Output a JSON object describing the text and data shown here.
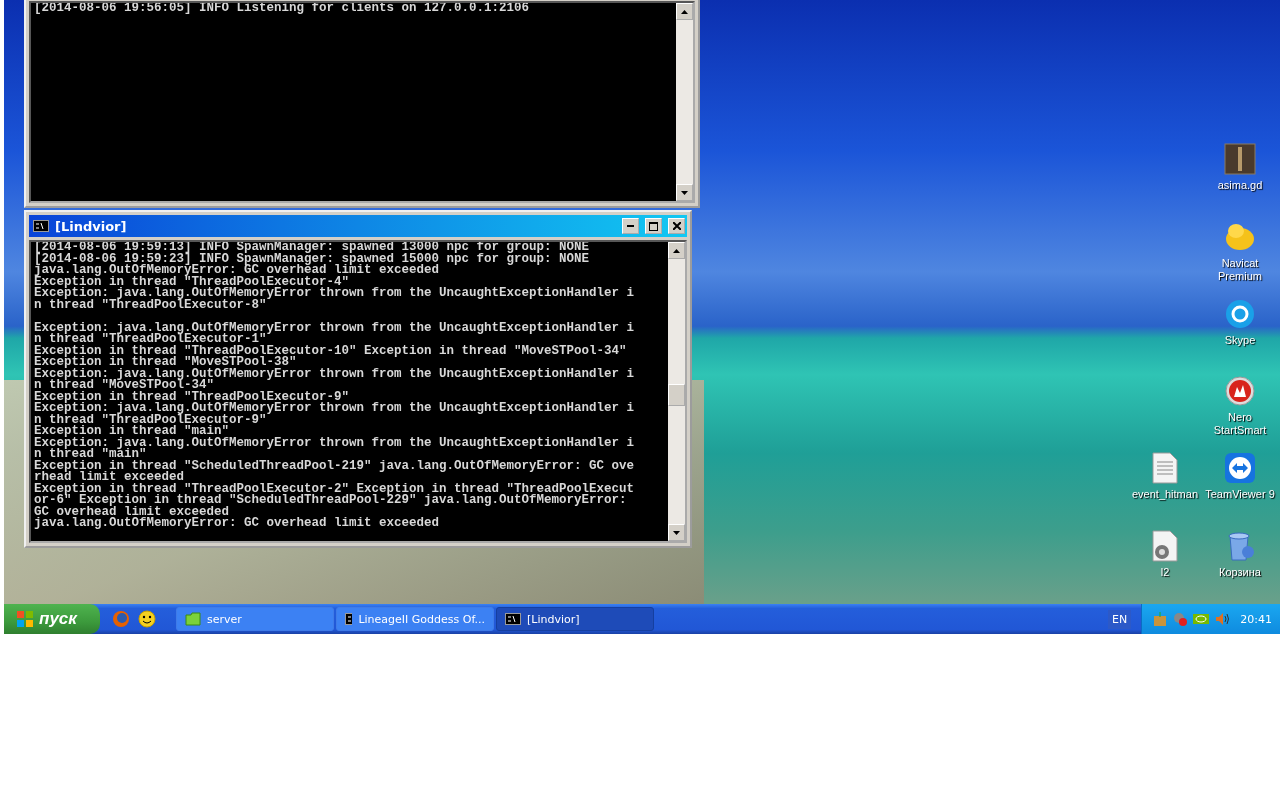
{
  "desktop": {
    "icons": [
      {
        "label": "asima.gd",
        "kind": "game"
      },
      {
        "label": "Navicat Premium",
        "kind": "navicat"
      },
      {
        "label": "Skype",
        "kind": "skype"
      },
      {
        "label": "Nero StartSmart",
        "kind": "nero"
      },
      {
        "label": "event_hitman",
        "kind": "document"
      },
      {
        "label": "TeamViewer 9",
        "kind": "teamviewer"
      },
      {
        "label": "l2",
        "kind": "settings-file"
      },
      {
        "label": "Корзина",
        "kind": "recycle-bin"
      }
    ]
  },
  "windows": [
    {
      "kind": "console-no-title",
      "paragraphs": [
        [
          "[2014-08-06 19:56:05] INFO Listening for clients on 127.0.0.1:2106"
        ]
      ]
    },
    {
      "kind": "console",
      "title": "[Lindvior]",
      "paragraphs": [
        [
          "[2014-08-06 19:59:13] INFO SpawnManager: spawned 13000 npc for group: NONE",
          "[2014-08-06 19:59:23] INFO SpawnManager: spawned 15000 npc for group: NONE",
          "java.lang.OutOfMemoryError: GC overhead limit exceeded",
          "Exception in thread \"ThreadPoolExecutor-4\"",
          "Exception: java.lang.OutOfMemoryError thrown from the UncaughtExceptionHandler i",
          "n thread \"ThreadPoolExecutor-8\""
        ],
        [
          "Exception: java.lang.OutOfMemoryError thrown from the UncaughtExceptionHandler i",
          "n thread \"ThreadPoolExecutor-1\"",
          "Exception in thread \"ThreadPoolExecutor-10\" Exception in thread \"MoveSTPool-34\"",
          "Exception in thread \"MoveSTPool-38\"",
          "Exception: java.lang.OutOfMemoryError thrown from the UncaughtExceptionHandler i",
          "n thread \"MoveSTPool-34\"",
          "Exception in thread \"ThreadPoolExecutor-9\"",
          "Exception: java.lang.OutOfMemoryError thrown from the UncaughtExceptionHandler i",
          "n thread \"ThreadPoolExecutor-9\"",
          "Exception in thread \"main\"",
          "Exception: java.lang.OutOfMemoryError thrown from the UncaughtExceptionHandler i",
          "n thread \"main\"",
          "Exception in thread \"ScheduledThreadPool-219\" java.lang.OutOfMemoryError: GC ove",
          "rhead limit exceeded",
          "Exception in thread \"ThreadPoolExecutor-2\" Exception in thread \"ThreadPoolExecut",
          "or-6\" Exception in thread \"ScheduledThreadPool-229\" java.lang.OutOfMemoryError:",
          "GC overhead limit exceeded",
          "java.lang.OutOfMemoryError: GC overhead limit exceeded"
        ]
      ]
    }
  ],
  "taskbar": {
    "start": "пуск",
    "quick_launch": [
      {
        "kind": "browser"
      },
      {
        "kind": "smiley"
      }
    ],
    "tasks": [
      {
        "label": "server",
        "kind": "folder",
        "selected": false
      },
      {
        "label": "LineageII Goddess Of...",
        "kind": "console",
        "selected": false
      },
      {
        "label": "[Lindvior]",
        "kind": "console",
        "selected": true
      }
    ],
    "language": "EN",
    "tray": [
      {
        "kind": "package"
      },
      {
        "kind": "network"
      },
      {
        "kind": "graphics"
      },
      {
        "kind": "volume"
      }
    ],
    "clock": "20:41"
  }
}
